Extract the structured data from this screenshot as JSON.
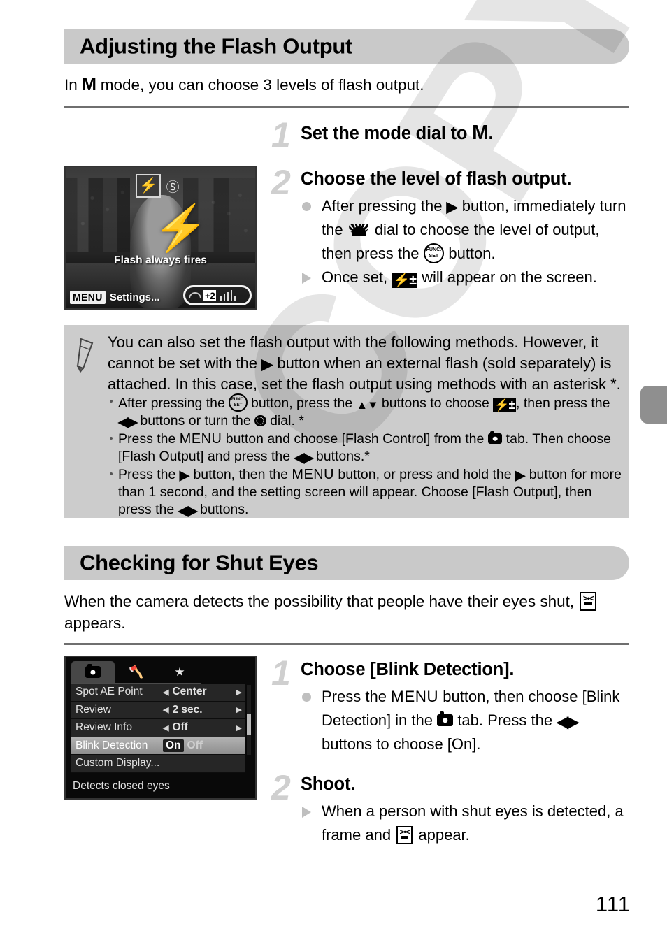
{
  "watermark": {
    "text": "COPY"
  },
  "page": {
    "number": "111"
  },
  "sections": [
    {
      "heading": "Adjusting the Flash Output",
      "intro_before": "In ",
      "intro_mode": "M",
      "intro_after": " mode, you can choose 3 levels of flash output."
    },
    {
      "heading": "Checking for Shut Eyes",
      "intro_before": "When the camera detects the possibility that people have their eyes shut, ",
      "intro_after": " appears."
    }
  ],
  "flash_steps": [
    {
      "num": "1",
      "title_before": "Set the mode dial to ",
      "title_icon": "M",
      "title_after": "."
    },
    {
      "num": "2",
      "title": "Choose the level of flash output.",
      "bullets": [
        {
          "marker": "dot",
          "p1": "After pressing the ",
          "icon1": "right-button-icon",
          "p2": " button, immediately turn the ",
          "icon2": "control-dial-icon",
          "p3": " dial to choose the level of output, then press the ",
          "icon3": "func-set-icon",
          "p4": " button."
        },
        {
          "marker": "triangle",
          "p1": "Once set, ",
          "icon1": "flash-exposure-icon",
          "p2": " will appear on the screen."
        }
      ]
    }
  ],
  "note": {
    "icon": "pencil-icon",
    "main_p1": "You can also set the flash output with the following methods. However, it cannot be set with the ",
    "main_icon": "right-button-icon",
    "main_p2": " button when an external flash (sold separately) is attached. In this case, set the flash output using methods with an asterisk *.",
    "bullets": [
      {
        "p1": "After pressing the ",
        "icon1": "func-set-icon",
        "p2": " button, press the ",
        "icon2": "up-down-buttons-icon",
        "p3": " buttons to choose ",
        "icon3": "flash-exposure-icon",
        "p4": ", then press the ",
        "icon4": "left-right-buttons-icon",
        "p5": " buttons or turn the ",
        "icon5": "dial-icon",
        "p6": " dial. *"
      },
      {
        "p1": "Press the ",
        "icon1": "menu-button-icon",
        "p2": " button and choose [Flash Control] from the ",
        "icon2": "camera-tab-icon",
        "p3": " tab. Then choose [Flash Output] and press the ",
        "icon3": "left-right-buttons-icon",
        "p4": " buttons.*"
      },
      {
        "p1": "Press the ",
        "icon1": "right-button-icon",
        "p2": " button, then the ",
        "icon2": "menu-button-icon",
        "p3": " button, or press and hold the ",
        "icon3": "right-button-icon",
        "p4": " button for more than 1 second, and the setting screen will appear. Choose [Flash Output], then press the ",
        "icon4": "left-right-buttons-icon",
        "p5": " buttons."
      }
    ]
  },
  "blink_steps": [
    {
      "num": "1",
      "title": "Choose [Blink Detection].",
      "bullets": [
        {
          "marker": "dot",
          "p1": "Press the ",
          "icon1": "menu-button-icon",
          "p2": " button, then choose [Blink Detection] in the ",
          "icon2": "camera-tab-icon",
          "p3": " tab. Press the ",
          "icon3": "left-right-buttons-icon",
          "p4": " buttons to choose [On]."
        }
      ]
    },
    {
      "num": "2",
      "title": "Shoot.",
      "bullets": [
        {
          "marker": "triangle",
          "p1": "When a person with shut eyes is detected, a frame and ",
          "icon1": "blink-detection-icon",
          "p2": " appear."
        }
      ]
    }
  ],
  "photo_screenshot": {
    "flash_mode_icon": "flash-on-icon",
    "redeye_icon": "red-eye-icon",
    "caption": "Flash always fires",
    "menu_chip": "MENU",
    "menu_label": "Settings...",
    "bar_flash_value": "+2"
  },
  "menu_screenshot": {
    "tabs": [
      {
        "name": "camera-tab",
        "glyph": "camera"
      },
      {
        "name": "settings-tab",
        "glyph": "wrench"
      },
      {
        "name": "favorites-tab",
        "glyph": "star"
      }
    ],
    "rows": [
      {
        "label": "Spot AE Point",
        "value": "Center",
        "type": "arrows"
      },
      {
        "label": "Review",
        "value": "2 sec.",
        "type": "arrows"
      },
      {
        "label": "Review Info",
        "value": "Off",
        "type": "arrows"
      },
      {
        "label": "Blink Detection",
        "on": "On",
        "off": "Off",
        "type": "toggle",
        "selected": true
      },
      {
        "label": "Custom Display...",
        "value": "",
        "type": "plain"
      }
    ],
    "footer": "Detects closed eyes"
  }
}
